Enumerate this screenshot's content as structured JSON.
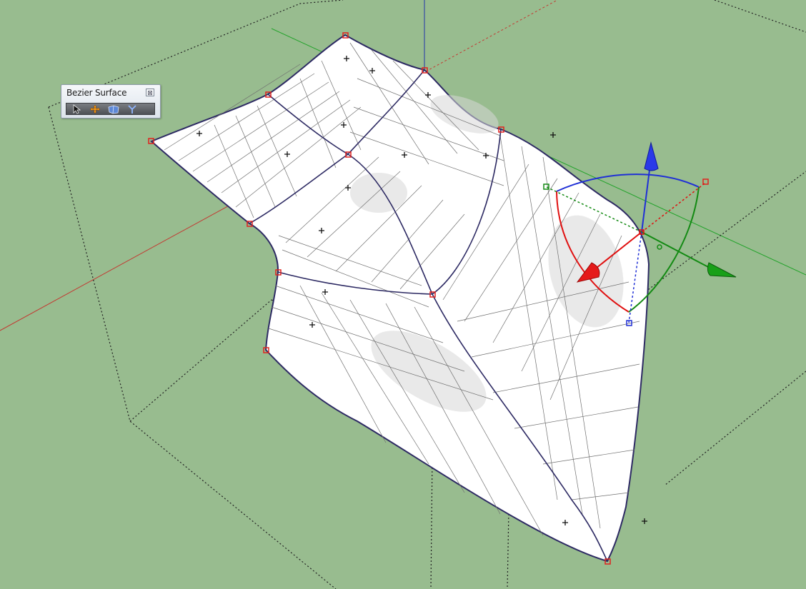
{
  "toolbar": {
    "title": "Bezier Surface",
    "close_glyph": "⊠",
    "tools": [
      {
        "name": "select",
        "icon": "arrow-cursor-icon"
      },
      {
        "name": "move",
        "icon": "move-arrows-icon"
      },
      {
        "name": "surface",
        "icon": "surface-patch-icon"
      },
      {
        "name": "split",
        "icon": "split-edge-icon"
      }
    ]
  },
  "colors": {
    "background": "#98bc8f",
    "surface": "#ffffff",
    "surface_edge": "#2d2a63",
    "mesh_line": "#6c6c6c",
    "control_point": "#e0221f",
    "axis_red": "#e01010",
    "axis_green": "#138a13",
    "axis_blue": "#1f2fd6"
  }
}
